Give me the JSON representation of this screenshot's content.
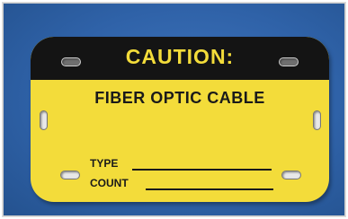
{
  "label": {
    "banner_text": "CAUTION:",
    "subtitle": "FIBER OPTIC CABLE",
    "fields": [
      {
        "label": "TYPE"
      },
      {
        "label": "COUNT"
      }
    ]
  },
  "colors": {
    "background": "#2f62a8",
    "tag": "#f3dc3a",
    "banner": "#141414",
    "text": "#1a1a1a"
  }
}
